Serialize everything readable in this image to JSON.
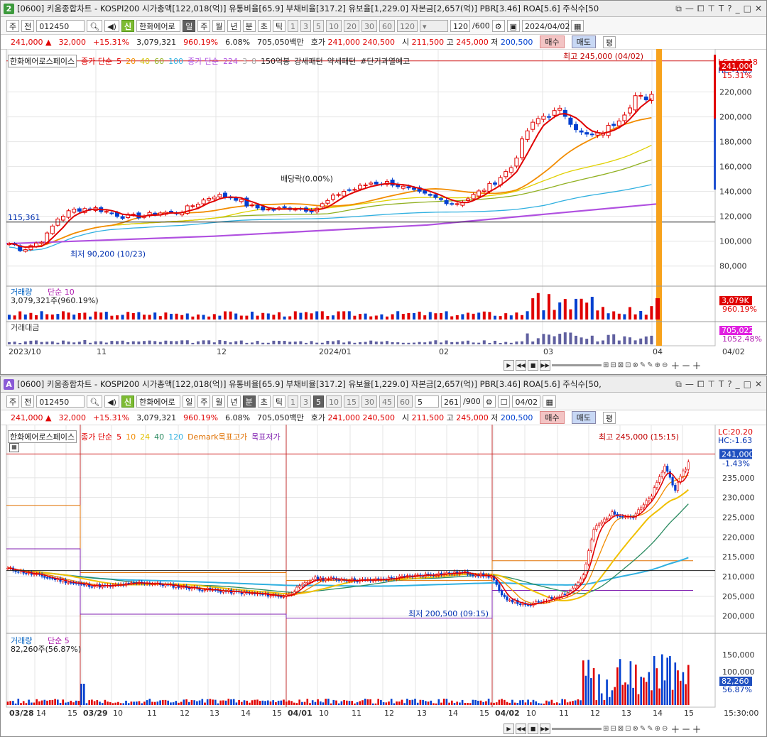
{
  "colors": {
    "up": "#e00000",
    "down": "#0040d0",
    "ma5": "#e00000",
    "ma20": "#f28c00",
    "ma40": "#e0d000",
    "ma60": "#90b020",
    "ma100": "#30b0e0",
    "ma224": "#b050e0",
    "vol": "#d02020",
    "gridline": "#e4e4e4"
  },
  "window1": {
    "badge": "2",
    "title": "[0600] 키움종합차트 - KOSPI200 시가총액[122,018(억)] 유통비율[65.9] 부채비율[317.2] 유보율[1,229.0] 자본금[2,657(억)] PBR[3.46] ROA[5.6] 주식수[50",
    "toolbar": {
      "type": "주",
      "prefix": "전",
      "code": "012450",
      "sin": "신",
      "name": "한화에어로",
      "periods": [
        "일",
        "주",
        "월",
        "년"
      ],
      "ticks": [
        "분",
        "초",
        "틱"
      ],
      "numbers": [
        "1",
        "3",
        "5",
        "10",
        "20",
        "30",
        "60",
        "120"
      ],
      "count": "120",
      "count_max": "/600",
      "date": "2024/04/02"
    },
    "info": {
      "price": "241,000",
      "arrow": "▲",
      "change": "32,000",
      "pct": "+15.31%",
      "volume": "3,079,321",
      "vol_pct": "960.19%",
      "turnover": "6.08%",
      "amount": "705,050백만",
      "bid_label": "호가",
      "ask": "241,000",
      "bid": "240,500",
      "open_label": "시",
      "open": "211,500",
      "high_label": "고",
      "high": "245,000",
      "low_label": "저",
      "low": "200,500",
      "buy": "매수",
      "sell": "매도",
      "flat": "평"
    },
    "legend": {
      "stock": "한화에어로스페이스",
      "ma_label": "종가 단순",
      "ma_periods": [
        "5",
        "20",
        "40",
        "60",
        "100"
      ],
      "ma2_label": "종가 단순",
      "ma2_periods": [
        "224",
        "3",
        "8"
      ],
      "patterns": [
        "150억봉",
        "강세패턴",
        "약세패턴",
        "#단기과열예고"
      ]
    },
    "annotations": {
      "high": "최고 245,000 (04/02)",
      "low": "최저 90,200 (10/23)",
      "dividend": "배당락(0.00%)",
      "ref_price": "115,361"
    },
    "right_labels": {
      "lc": "LC:167.18",
      "hc": "HC:-1.63",
      "price": "241,000",
      "pct": "15.31%"
    },
    "price_axis": [
      "220,000",
      "200,000",
      "180,000",
      "160,000",
      "140,000",
      "120,000",
      "100,000",
      "80,000"
    ],
    "vol_pane": {
      "title": "거래량",
      "ma": "단순 10",
      "value": "3,079,321주(960.19%)",
      "right1": "3,079K",
      "right2": "960.19%"
    },
    "amt_pane": {
      "title": "거래대금",
      "right1": "705,022",
      "right2": "1052.48%"
    },
    "date_axis": [
      "2023/10",
      "11",
      "12",
      "2024/01",
      "02",
      "03",
      "04"
    ],
    "date_right": "04/02"
  },
  "window2": {
    "badge": "A",
    "title": "[0600] 키움종합차트 - KOSPI200 시가총액[122,018(억)] 유통비율[65.9] 부채비율[317.2] 유보율[1,229.0] 자본금[2,657(억)] PBR[3.46] ROA[5.6] 주식수[50,",
    "toolbar": {
      "type": "주",
      "prefix": "전",
      "code": "012450",
      "sin": "신",
      "name": "한화에어로",
      "periods": [
        "일",
        "주",
        "월",
        "년"
      ],
      "ticks": [
        "분",
        "초",
        "틱"
      ],
      "numbers": [
        "1",
        "3",
        "5",
        "10",
        "15",
        "30",
        "45",
        "60"
      ],
      "minute": "5",
      "count": "261",
      "count_max": "/900",
      "date": "04/02"
    },
    "info": {
      "price": "241,000",
      "arrow": "▲",
      "change": "32,000",
      "pct": "+15.31%",
      "volume": "3,079,321",
      "vol_pct": "960.19%",
      "turnover": "6.08%",
      "amount": "705,050백만",
      "bid_label": "호가",
      "ask": "241,000",
      "bid": "240,500",
      "open_label": "시",
      "open": "211,500",
      "high_label": "고",
      "high": "245,000",
      "low_label": "저",
      "low": "200,500",
      "buy": "매수",
      "sell": "매도",
      "flat": "평"
    },
    "legend": {
      "stock": "한화에어로스페이스",
      "ma_label": "종가 단순",
      "ma_periods": [
        "5",
        "10",
        "24",
        "40",
        "120"
      ],
      "demark": "Demark목표고가",
      "demark2": "목표저가"
    },
    "annotations": {
      "high": "최고 245,000 (15:15)",
      "low": "최저 200,500 (09:15)"
    },
    "right_labels": {
      "lc": "LC:20.20",
      "hc": "HC:-1.63",
      "price": "241,000",
      "pct": "-1.43%"
    },
    "price_axis": [
      "235,000",
      "230,000",
      "225,000",
      "220,000",
      "215,000",
      "210,000",
      "205,000",
      "200,000"
    ],
    "vol_pane": {
      "title": "거래량",
      "ma": "단순 5",
      "value": "82,260주(56.87%)",
      "axis": [
        "150,000",
        "100,000"
      ],
      "right1": "82,260",
      "right2": "56.87%"
    },
    "date_axis": [
      "03/28",
      "14",
      "15",
      "03/29",
      "10",
      "11",
      "12",
      "13",
      "14",
      "15",
      "04/01",
      "10",
      "11",
      "12",
      "13",
      "14",
      "15",
      "04/02",
      "10",
      "11",
      "12",
      "13",
      "14",
      "15"
    ],
    "date_right": "15:30:00"
  }
}
